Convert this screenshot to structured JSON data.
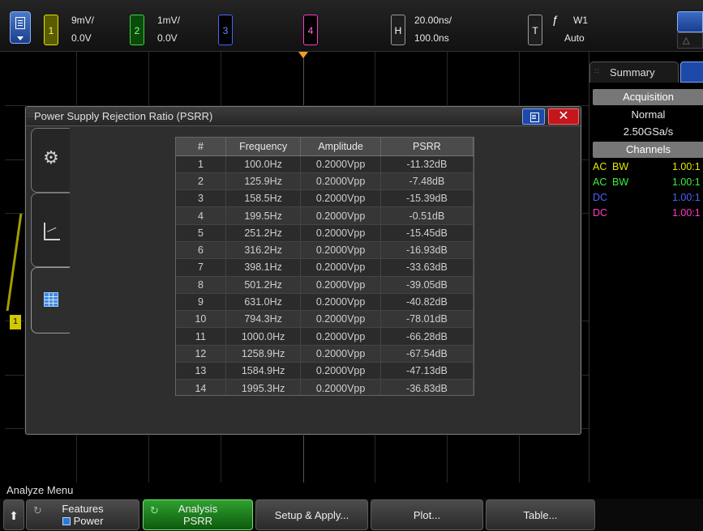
{
  "topbar": {
    "ch1": {
      "num": "1",
      "scale": "9mV/",
      "offset": "0.0V"
    },
    "ch2": {
      "num": "2",
      "scale": "1mV/",
      "offset": "0.0V"
    },
    "ch3": {
      "num": "3"
    },
    "ch4": {
      "num": "4"
    },
    "horizontal": {
      "label": "H",
      "scale": "20.00ns/",
      "delay": "100.0ns"
    },
    "trigger": {
      "label": "T",
      "source": "W1",
      "mode": "Auto"
    }
  },
  "dialog": {
    "title": "Power Supply Rejection Ratio (PSRR)",
    "close": "✕",
    "columns": [
      "#",
      "Frequency",
      "Amplitude",
      "PSRR"
    ],
    "rows": [
      [
        "1",
        "100.0Hz",
        "0.2000Vpp",
        "-11.32dB"
      ],
      [
        "2",
        "125.9Hz",
        "0.2000Vpp",
        "-7.48dB"
      ],
      [
        "3",
        "158.5Hz",
        "0.2000Vpp",
        "-15.39dB"
      ],
      [
        "4",
        "199.5Hz",
        "0.2000Vpp",
        "-0.51dB"
      ],
      [
        "5",
        "251.2Hz",
        "0.2000Vpp",
        "-15.45dB"
      ],
      [
        "6",
        "316.2Hz",
        "0.2000Vpp",
        "-16.93dB"
      ],
      [
        "7",
        "398.1Hz",
        "0.2000Vpp",
        "-33.63dB"
      ],
      [
        "8",
        "501.2Hz",
        "0.2000Vpp",
        "-39.05dB"
      ],
      [
        "9",
        "631.0Hz",
        "0.2000Vpp",
        "-40.82dB"
      ],
      [
        "10",
        "794.3Hz",
        "0.2000Vpp",
        "-78.01dB"
      ],
      [
        "11",
        "1000.0Hz",
        "0.2000Vpp",
        "-66.28dB"
      ],
      [
        "12",
        "1258.9Hz",
        "0.2000Vpp",
        "-67.54dB"
      ],
      [
        "13",
        "1584.9Hz",
        "0.2000Vpp",
        "-47.13dB"
      ],
      [
        "14",
        "1995.3Hz",
        "0.2000Vpp",
        "-36.83dB"
      ]
    ]
  },
  "sidebar": {
    "tab": "Summary",
    "acquisition_header": "Acquisition",
    "acq_mode": "Normal",
    "sample_rate": "2.50GSa/s",
    "channels_header": "Channels",
    "channels": [
      {
        "coupling": "AC",
        "bw": "BW",
        "probe": "1.00:1",
        "color": "#e6e600"
      },
      {
        "coupling": "AC",
        "bw": "BW",
        "probe": "1.00:1",
        "color": "#3cf03c"
      },
      {
        "coupling": "DC",
        "bw": "",
        "probe": "1.00:1",
        "color": "#4a64ff"
      },
      {
        "coupling": "DC",
        "bw": "",
        "probe": "1.00:1",
        "color": "#ff3cc4"
      }
    ]
  },
  "menu": {
    "title": "Analyze Menu",
    "features_label": "Features",
    "features_value": "Power",
    "analysis_label": "Analysis",
    "analysis_value": "PSRR",
    "setup": "Setup & Apply...",
    "plot": "Plot...",
    "table": "Table..."
  },
  "icons": {
    "menu": "main-menu-icon",
    "back": "up-arrow-icon",
    "settings": "gear-icon",
    "plot": "plot-icon",
    "table": "table-icon"
  }
}
